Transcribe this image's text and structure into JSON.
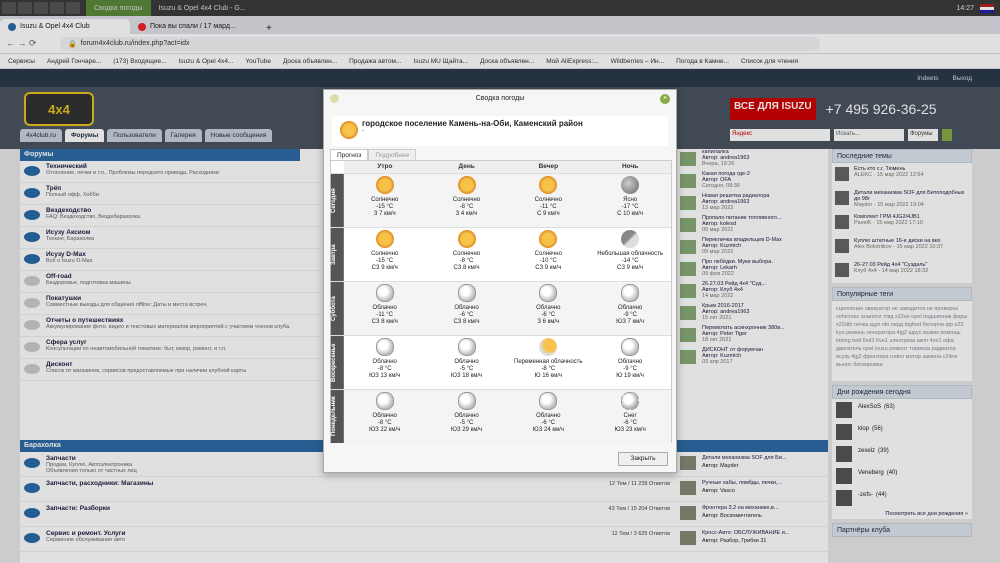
{
  "os": {
    "tab1": "Сводка погоды",
    "tab2": "Isuzu & Opel 4x4 Club - G...",
    "time": "14:27"
  },
  "browser": {
    "tabs": [
      "Isuzu & Opel 4x4 Club",
      "Пока вы спали / 17 мард..."
    ],
    "url": "forum4x4club.ru/index.php?act=idx",
    "bookmarks": [
      "Сервисы",
      "Андрей Гончаре...",
      "(173) Входящие...",
      "Isuzu & Opel 4x4...",
      "YouTube",
      "Доска объявлен...",
      "Продажа автом...",
      "Isuzu MU Щайта...",
      "Доска объявлен...",
      "Мой AliExpress:...",
      "Wildberries – Ин...",
      "Погода в Камне...",
      "Список для чтения"
    ]
  },
  "site": {
    "user": "Indeets",
    "logout": "Выход",
    "nav": [
      "4x4club.ru",
      "Форумы",
      "Пользователи",
      "Галерея",
      "Новые сообщения"
    ],
    "ad_brand": "ВСЕ ДЛЯ ISUZU",
    "ad_phone": "+7 495 926-36-25",
    "search_label": "Искать...",
    "search_scope": "Форумы",
    "yandex": "Яндекс"
  },
  "forums": {
    "title": "Форумы",
    "items": [
      {
        "t": "Технический",
        "d": "Отопление, печки и т.п.,  Проблемы переднего привода,  Расходники"
      },
      {
        "t": "Трёп",
        "d": "Полный офф, Хобби"
      },
      {
        "t": "Вездеходство",
        "d": "FAQ: Вездеходство,  Вездебарахолка"
      },
      {
        "t": "Исузу Аксиом",
        "d": "Тюнинг,  Барахолка"
      },
      {
        "t": "Исузу D-Max",
        "d": "Всё о Isuzu D-Max"
      },
      {
        "t": "Off-road",
        "d": "Бездорожье, подготовка машины"
      },
      {
        "t": "Покатушки",
        "d": "Совместные выезды для общения offline: Даты и места встреч."
      },
      {
        "t": "Отчеты о путешествиях",
        "d": "Аккумулирование фото, видео и текстовых материалов мероприятий с участием членов клуба."
      },
      {
        "t": "Сфера услуг",
        "d": "Консультации по неавтомобильной тематике: быт, юмор, ремонт, и т.п."
      },
      {
        "t": "Дисконт",
        "d": "Список от магазинов, сервисов предоставляемые при наличии клубной карты"
      }
    ]
  },
  "recent": [
    {
      "t": "капилалка",
      "a": "Автор: andrea1963",
      "d": "Вчера, 19:26"
    },
    {
      "t": "Какая погода где-2",
      "a": "Автор: OFA",
      "d": "Сегодня, 08:36"
    },
    {
      "t": "Новая решетка радиатора",
      "a": "Автор: andrea1963",
      "d": "13 мар 2022"
    },
    {
      "t": "Пропало питание топливного...",
      "a": "Автор: kolesd",
      "d": "09 мар 2022"
    },
    {
      "t": "Перекличка владельцев D-Max",
      "a": "Автор: Kuzmich",
      "d": "09 мар 2022"
    },
    {
      "t": "Про лебёдки. Муки выбора.",
      "a": "Автор: Lekarh",
      "d": "09 фев 2022"
    },
    {
      "t": "26.27.03 Рейд 4x4 \"Суд...",
      "a": "Автор: Клуб 4x4",
      "d": "14 мар 2022"
    },
    {
      "t": "Крым 2016-2017",
      "a": "Автор: andrea1963",
      "d": "15 окт 2021"
    },
    {
      "t": "Перемотать асинхронник 380в...",
      "a": "Автор: Peter Tiger",
      "d": "18 окт 2021"
    },
    {
      "t": "ДИСКОНТ от форумчан",
      "a": "Автор: Kuzmich",
      "d": "03 апр 2017"
    }
  ],
  "market": {
    "title": "Барахолка",
    "items": [
      {
        "t": "Запчасти",
        "d": "Продам,  Куплю,  Автоэлектроника",
        "d2": "Объявления только от частных лиц",
        "cnt": ""
      },
      {
        "t": "Запчасти, расходники: Магазины",
        "d": "",
        "d2": "",
        "cnt": "12 Тем / 11 239 Ответов"
      },
      {
        "t": "Запчасти: Разборки",
        "d": "",
        "d2": "",
        "cnt": "43 Тем / 15 204 Ответов"
      },
      {
        "t": "Сервис и ремонт. Услуги",
        "d": "Сервисное обслуживание авто",
        "d2": "",
        "cnt": "12 Тем / 3 625 Ответов"
      }
    ],
    "recent": [
      {
        "t": "Детали механизма SOF для Би...",
        "a": "Автор: Mayder",
        "d": "15 мар 2022"
      },
      {
        "t": "Ручные хабы, лямбды, печки,...",
        "a": "Автор: Vasco",
        "d": "09 мар 2022"
      },
      {
        "t": "Фронтера 3,2 на механике,в...",
        "a": "Автор: Восхомичтатель",
        "d": "Вчера, 20:11"
      },
      {
        "t": "Кросс-Авто: ОБСЛУЖИВАНИЕ и...",
        "a": "Автор: Разбор, Грибки 31",
        "d": "14 мар 2022"
      }
    ]
  },
  "sidebar": {
    "latest_title": "Последние темы",
    "latest": [
      {
        "t": "Есть кто с.г. Тюмень",
        "s": "ALEKC - 15 мар 2022 12:54"
      },
      {
        "t": "Детали механизма SOF для Битоподобных до 98г",
        "s": "Mayder - 15 мар 2022 19:04"
      },
      {
        "t": "Комплект ГРМ 4JG2/4JB1",
        "s": "PavelK - 15 мар 2022 17:10"
      },
      {
        "t": "Куплю штатные 16-е диски на вех",
        "s": "Alex Bolotnikov - 15 мар 2022 10:37"
      },
      {
        "t": "26-27.03 Рейд 4x4 \"Суздаль\"",
        "s": "Клуб 4x4 - 14 мар 2022 18:32"
      }
    ],
    "tags_title": "Популярные теги",
    "tags": "сцепление эвакуатор не заводится не проверка vehicross аналоги тгвд x22se opel подшипник фары x22dth печка щуп ntn перд bigfoot белорчи qtp x22 kyo ремень генератора 4jg2 шрус мужик помощь timing belt 6vd1 6ve1 электрика акпп 4ze1 офа двигатель opel isuzu ремонт тормоза радиатор исузу 4jg2 фронтера rodeo мотор замена c24ne вынос блокировка",
    "bday_title": "Дни рождения сегодня",
    "bday": [
      {
        "n": "AlexSoS",
        "a": "(63)"
      },
      {
        "n": "klop",
        "a": "(56)"
      },
      {
        "n": "zexelz",
        "a": "(39)"
      },
      {
        "n": "Veneberg",
        "a": "(40)"
      },
      {
        "n": "-zefs-",
        "a": "(44)"
      }
    ],
    "bday_more": "Посмотреть все дни рождения »",
    "partners": "Партнёры клуба"
  },
  "modal": {
    "title": "Сводка погоды",
    "location": "городское поселение Камень-на-Оби, Каменский район",
    "sub": "-",
    "tab_now": "Прогноз",
    "tab_more": "Подробнее",
    "cols": [
      "Утро",
      "День",
      "Вечер",
      "Ночь"
    ],
    "close": "Закрыть",
    "rows": [
      {
        "day": "Сегодня",
        "cells": [
          {
            "icon": "sun",
            "c": "Солнечно",
            "t": "-15 °C",
            "w": "З 7 км/ч"
          },
          {
            "icon": "sun",
            "c": "Солнечно",
            "t": "-8 °C",
            "w": "З 4 км/ч"
          },
          {
            "icon": "sun",
            "c": "Солнечно",
            "t": "-11 °C",
            "w": "С 9 км/ч"
          },
          {
            "icon": "moon",
            "c": "Ясно",
            "t": "-17 °C",
            "w": "С 10 км/ч"
          }
        ]
      },
      {
        "day": "Завтра",
        "cells": [
          {
            "icon": "sun",
            "c": "Солнечно",
            "t": "-15 °C",
            "w": "СЗ 9 км/ч"
          },
          {
            "icon": "sun",
            "c": "Солнечно",
            "t": "-8 °C",
            "w": "СЗ 8 км/ч"
          },
          {
            "icon": "sun",
            "c": "Солнечно",
            "t": "-10 °C",
            "w": "СЗ 9 км/ч"
          },
          {
            "icon": "mcloud",
            "c": "Небольшая облачность",
            "t": "-14 °C",
            "w": "СЗ 9 км/ч"
          }
        ]
      },
      {
        "day": "Суббота",
        "cells": [
          {
            "icon": "cloud",
            "c": "Облачно",
            "t": "-11 °C",
            "w": "СЗ 8 км/ч"
          },
          {
            "icon": "cloud",
            "c": "Облачно",
            "t": "-6 °C",
            "w": "СЗ 8 км/ч"
          },
          {
            "icon": "cloud",
            "c": "Облачно",
            "t": "-6 °C",
            "w": "З 6 км/ч"
          },
          {
            "icon": "cloud",
            "c": "Облачно",
            "t": "-9 °C",
            "w": "ЮЗ 7 км/ч"
          }
        ]
      },
      {
        "day": "Воскресенье",
        "cells": [
          {
            "icon": "cloud",
            "c": "Облачно",
            "t": "-8 °C",
            "w": "ЮЗ 13 км/ч"
          },
          {
            "icon": "cloud",
            "c": "Облачно",
            "t": "-5 °C",
            "w": "ЮЗ 18 км/ч"
          },
          {
            "icon": "psun",
            "c": "Переменная облачность",
            "t": "-8 °C",
            "w": "Ю 16 км/ч"
          },
          {
            "icon": "cloud",
            "c": "Облачно",
            "t": "-9 °C",
            "w": "Ю 19 км/ч"
          }
        ]
      },
      {
        "day": "Понедельник",
        "cells": [
          {
            "icon": "cloud",
            "c": "Облачно",
            "t": "-8 °C",
            "w": "ЮЗ 22 км/ч"
          },
          {
            "icon": "cloud",
            "c": "Облачно",
            "t": "-5 °C",
            "w": "ЮЗ 29 км/ч"
          },
          {
            "icon": "cloud",
            "c": "Облачно",
            "t": "-6 °C",
            "w": "ЮЗ 24 км/ч"
          },
          {
            "icon": "snow",
            "c": "Снег",
            "t": "-6 °C",
            "w": "ЮЗ 23 км/ч"
          }
        ]
      }
    ]
  }
}
